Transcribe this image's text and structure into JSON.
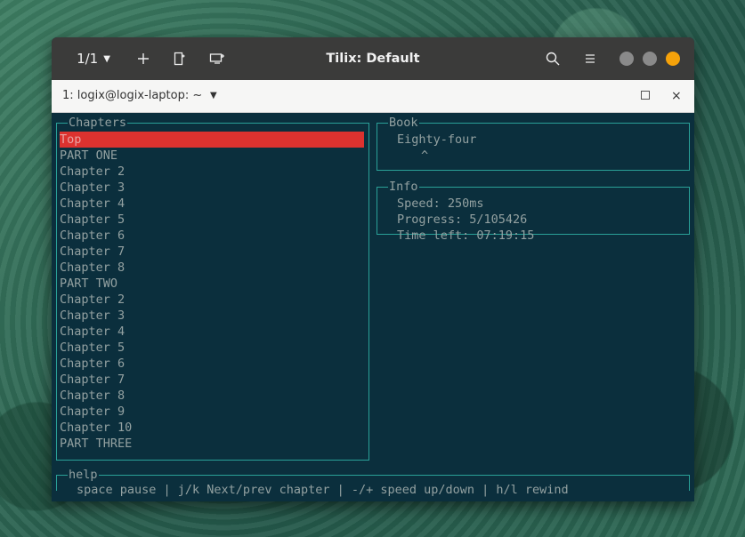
{
  "titlebar": {
    "session": "1/1",
    "title": "Tilix: Default",
    "icons": [
      "add-icon",
      "split-icon",
      "new-window-icon",
      "search-icon",
      "menu-icon"
    ],
    "window_buttons": [
      {
        "name": "minimize",
        "color": "#8a8a8a"
      },
      {
        "name": "maximize",
        "color": "#8a8a8a"
      },
      {
        "name": "close",
        "color": "#f5a20a"
      }
    ]
  },
  "tab": {
    "title": "1: logix@logix-laptop: ~",
    "close": "×"
  },
  "chapters": {
    "title": "Chapters",
    "items": [
      "Top",
      "PART ONE",
      "Chapter 2",
      "Chapter 3",
      "Chapter 4",
      "Chapter 5",
      "Chapter 6",
      "Chapter 7",
      "Chapter 8",
      "PART TWO",
      "Chapter 2",
      "Chapter 3",
      "Chapter 4",
      "Chapter 5",
      "Chapter 6",
      "Chapter 7",
      "Chapter 8",
      "Chapter 9",
      "Chapter 10",
      "PART THREE"
    ],
    "selected_index": 0
  },
  "book": {
    "title": "Book",
    "name": "Eighty-four",
    "cursor": "^"
  },
  "info": {
    "title": "Info",
    "speed": "Speed: 250ms",
    "progress": "Progress: 5/105426",
    "time_left": "Time left: 07:19:15"
  },
  "help": {
    "title": "help",
    "text": "space pause | j/k Next/prev chapter | -/+ speed up/down | h/l rewind"
  },
  "colors": {
    "terminal_bg": "#0b2f3d",
    "border": "#2aa198",
    "text": "#93a1a1",
    "selection": "#dc322f"
  }
}
